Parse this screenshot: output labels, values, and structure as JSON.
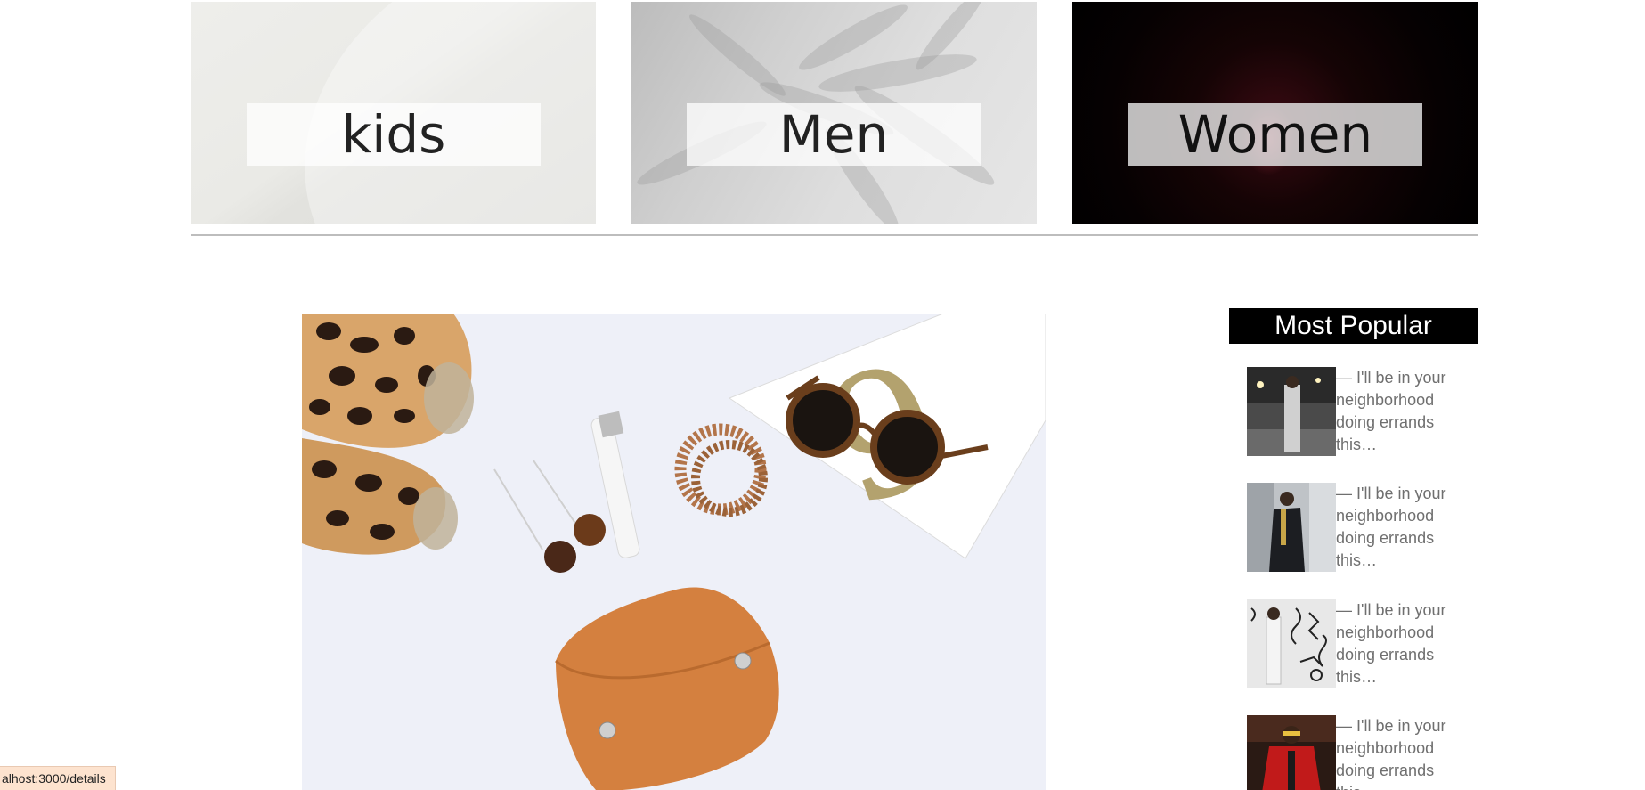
{
  "categories": [
    {
      "label": "kids"
    },
    {
      "label": "Men"
    },
    {
      "label": "Women"
    }
  ],
  "sidebar": {
    "title": "Most Popular",
    "items": [
      {
        "text": "— I'll be in your neighborhood doing errands this…"
      },
      {
        "text": "— I'll be in your neighborhood doing errands this…"
      },
      {
        "text": "— I'll be in your neighborhood doing errands this…"
      },
      {
        "text": "— I'll be in your neighborhood doing errands this…"
      }
    ]
  },
  "status_bar": {
    "url": "alhost:3000/details"
  },
  "colors": {
    "sidebar_header_bg": "#000000",
    "sidebar_text": "#6f6f6f",
    "divider": "#bdbdbd",
    "status_bg": "#fde3cf"
  }
}
